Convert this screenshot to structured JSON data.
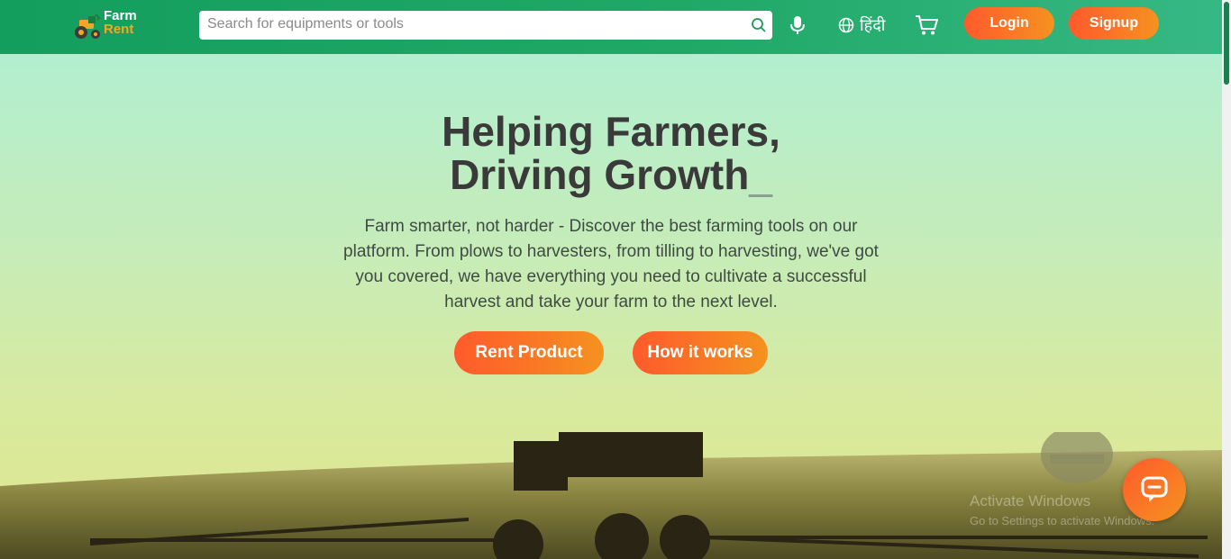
{
  "brand": {
    "line1": "Farm",
    "line2": "Rent"
  },
  "header": {
    "search_placeholder": "Search for equipments or tools",
    "language_label": "हिंदी",
    "login_label": "Login",
    "signup_label": "Signup"
  },
  "hero": {
    "headline_line1": "Helping Farmers,",
    "headline_line2": "Driving Growth",
    "cursor": "_",
    "description": "Farm smarter, not harder - Discover the best farming tools on our platform. From plows to harvesters, from tilling to harvesting, we've got you covered, we have everything you need to cultivate a successful harvest and take your farm to the next level.",
    "rent_label": "Rent Product",
    "how_label": "How it works"
  },
  "watermark": {
    "line1": "Activate Windows",
    "line2": "Go to Settings to activate Windows."
  },
  "icons": [
    "tractor-logo-icon",
    "search-icon",
    "mic-icon",
    "globe-icon",
    "cart-icon",
    "chat-icon"
  ],
  "colors": {
    "nav": "#149e5e",
    "accent_start": "#ff5a2c",
    "accent_end": "#f59220",
    "heading": "#3a3a3a"
  }
}
